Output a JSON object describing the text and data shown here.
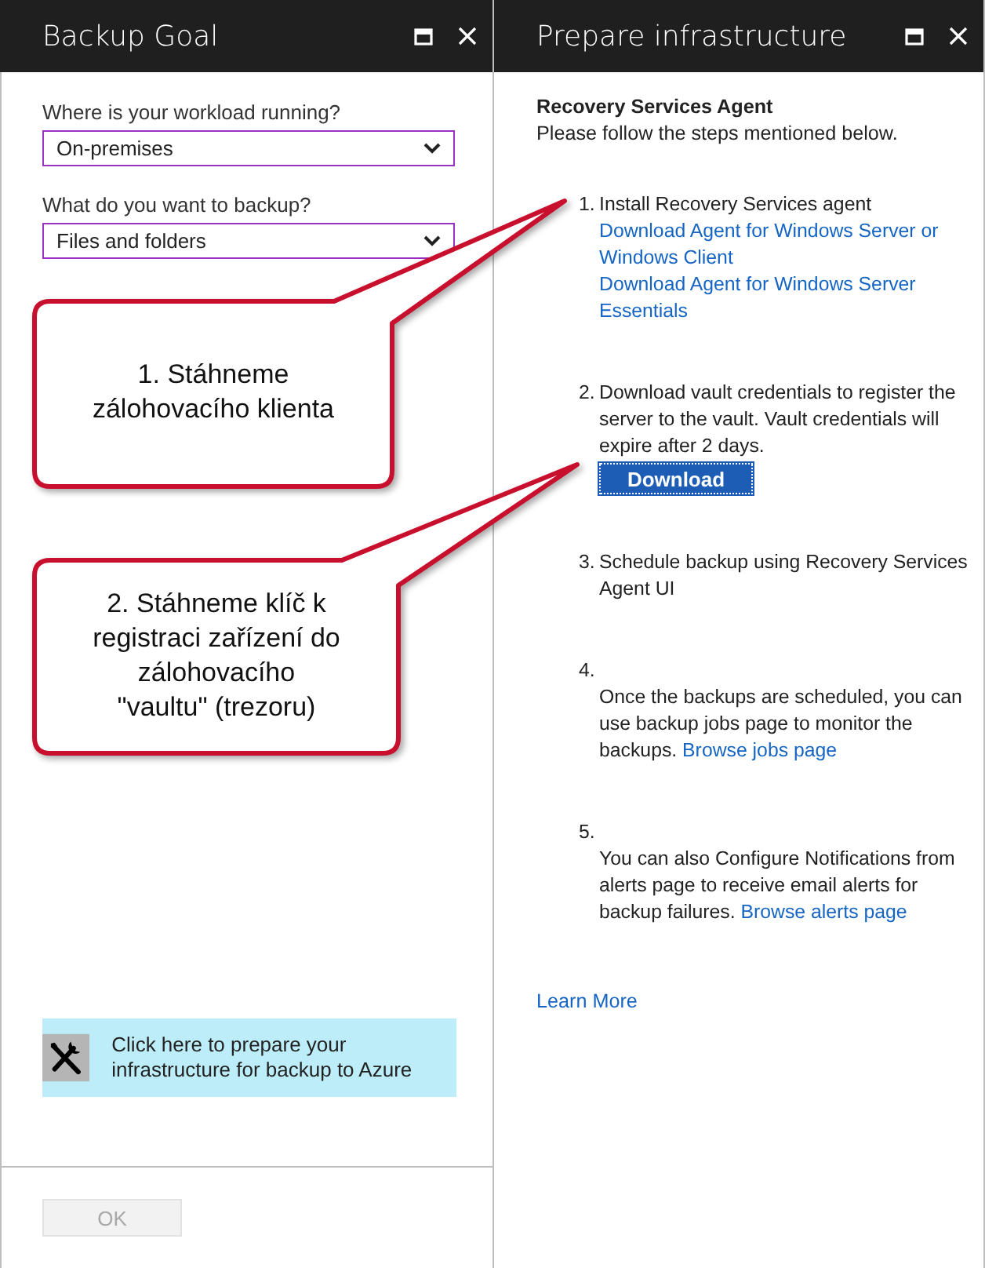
{
  "left_blade": {
    "title": "Backup Goal",
    "fields": [
      {
        "label": "Where is your workload running?",
        "value": "On-premises"
      },
      {
        "label": "What do you want to backup?",
        "value": "Files and folders"
      }
    ],
    "prepare_tile": {
      "text": "Click here to prepare your infrastructure for backup to Azure"
    },
    "ok_button": {
      "label": "OK",
      "disabled": true
    }
  },
  "right_blade": {
    "title": "Prepare infrastructure",
    "heading": "Recovery Services Agent",
    "intro": "Please follow the steps mentioned below.",
    "steps": [
      {
        "number": "1.",
        "number_on_own_line": false,
        "parts": [
          {
            "kind": "text",
            "text": "Install Recovery Services agent"
          },
          {
            "kind": "block_link",
            "text": "Download Agent for Windows Server or Windows Client"
          },
          {
            "kind": "block_link",
            "text": "Download Agent for Windows Server Essentials"
          }
        ]
      },
      {
        "number": "2.",
        "number_on_own_line": false,
        "parts": [
          {
            "kind": "text",
            "text": "Download vault credentials to register the server to the vault. Vault credentials will expire after 2 days."
          },
          {
            "kind": "button",
            "text": "Download"
          }
        ]
      },
      {
        "number": "3.",
        "number_on_own_line": false,
        "parts": [
          {
            "kind": "text",
            "text": "Schedule backup using Recovery Services Agent UI"
          }
        ]
      },
      {
        "number": "4.",
        "number_on_own_line": true,
        "parts": [
          {
            "kind": "text",
            "text": "Once the backups are scheduled, you can use backup jobs page to monitor the backups."
          },
          {
            "kind": "link",
            "text": "Browse jobs page"
          }
        ]
      },
      {
        "number": "5.",
        "number_on_own_line": true,
        "parts": [
          {
            "kind": "text",
            "text": "You can also Configure Notifications from alerts page to receive email alerts for backup failures."
          },
          {
            "kind": "link",
            "text": "Browse alerts page"
          }
        ]
      }
    ],
    "learn_more": "Learn More"
  },
  "callouts": [
    {
      "text": "1. Stáhneme\nzálohovacího klienta"
    },
    {
      "text": "2. Stáhneme klíč k\nregistraci zařízení do\nzálohovacího\n\"vaultu\" (trezoru)"
    }
  ]
}
